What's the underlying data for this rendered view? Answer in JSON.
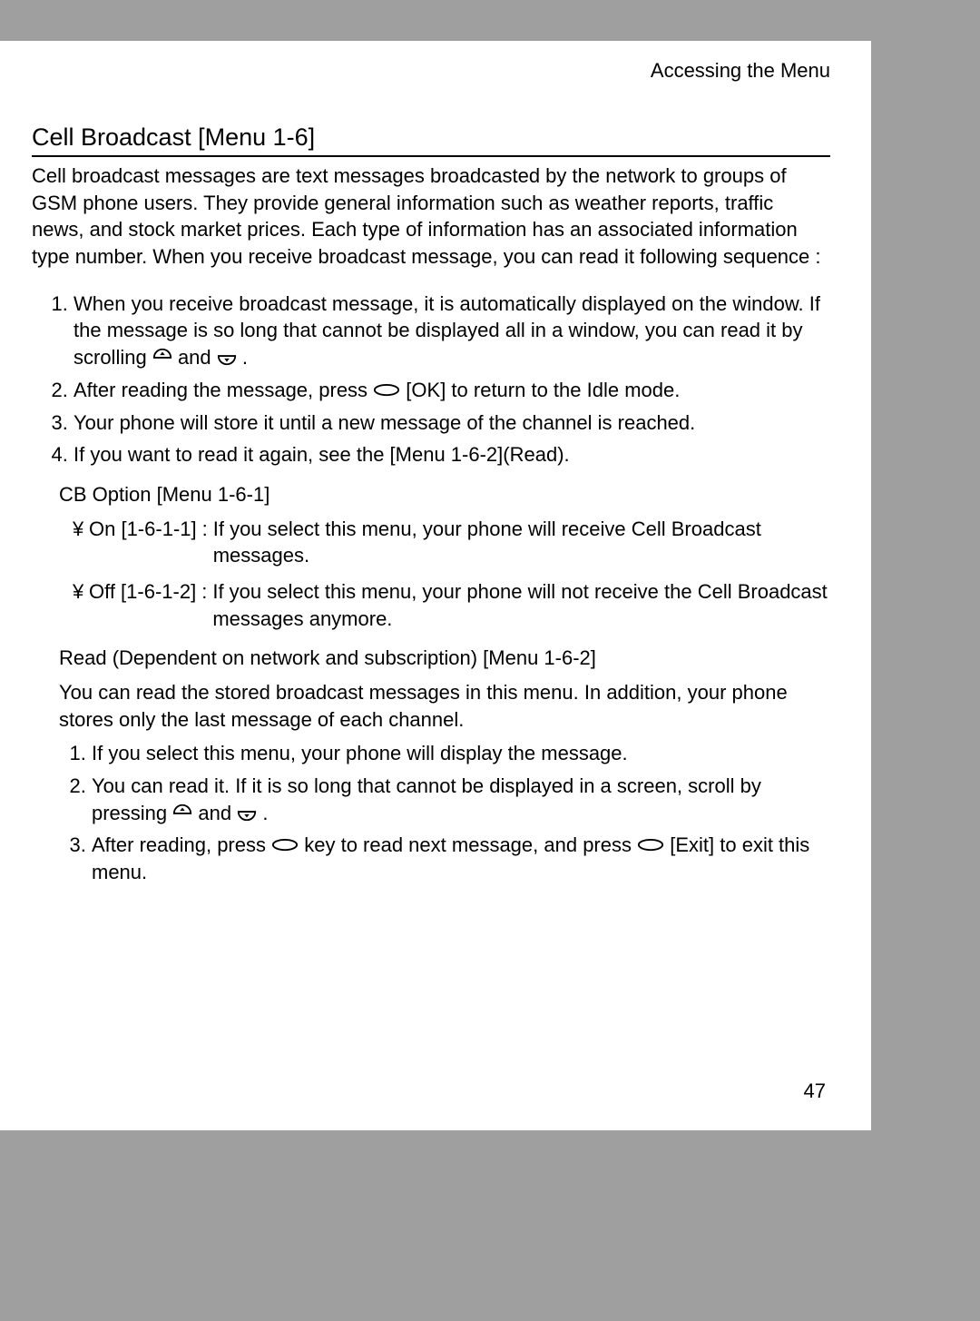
{
  "running_header": "Accessing the Menu",
  "section_title": "Cell Broadcast [Menu 1-6]",
  "intro": "Cell broadcast messages are text messages broadcasted by the network to groups of GSM phone users. They provide general information such as weather reports, traffic news, and stock market prices. Each type of information has an associated information type number. When you receive broadcast message, you can read it following sequence :",
  "list1": {
    "item1_a": "When you receive broadcast message, it is automatically displayed on the window. If the message is so long that cannot be displayed all in a window, you can read it by scrolling ",
    "item1_b": " and ",
    "item1_c": " .",
    "item2_a": "After reading the message, press ",
    "item2_b": " [OK] to return to the Idle mode.",
    "item3": "Your phone will store it until a new message of the channel is reached.",
    "item4": "If you want to read it again, see the [Menu 1-6-2](Read)."
  },
  "cb_option": {
    "title": "CB Option [Menu 1-6-1]",
    "bullet": "¥",
    "on_label": "On [1-6-1-1]",
    "on_desc": "If you select this menu, your phone will receive Cell Broadcast messages.",
    "off_label": "Off [1-6-1-2]",
    "off_desc": "If you select this menu, your phone will not receive the Cell Broadcast messages anymore."
  },
  "read": {
    "title": "Read (Dependent on network and subscription) [Menu 1-6-2]",
    "intro": "You can read the stored broadcast messages in this menu. In addition, your phone stores only the last message of each channel.",
    "item1": "If you select this menu, your phone will display the message.",
    "item2_a": "You can read it. If it is so long that cannot be displayed in a screen, scroll by pressing ",
    "item2_b": " and ",
    "item2_c": " .",
    "item3_a": "After reading, press ",
    "item3_b": " key to read next message, and press ",
    "item3_c": " [Exit] to exit this menu."
  },
  "page_number": "47"
}
